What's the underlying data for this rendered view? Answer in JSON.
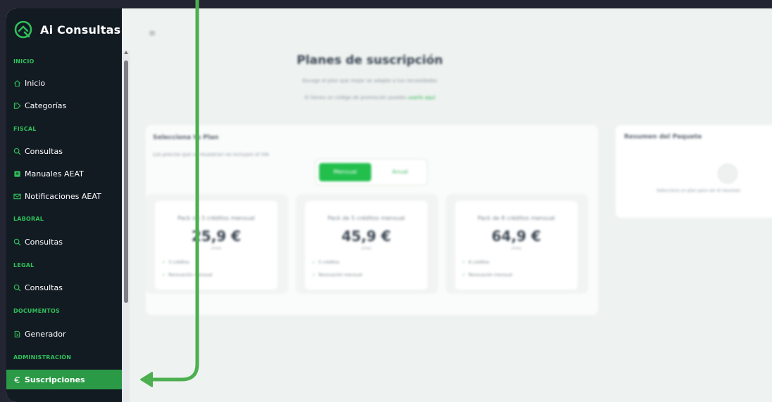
{
  "app": {
    "name": "Ai Consultas"
  },
  "sidebar": {
    "sections": [
      {
        "title": "INICIO",
        "items": [
          {
            "label": "Inicio",
            "icon": "home-icon"
          },
          {
            "label": "Categorías",
            "icon": "tag-icon"
          }
        ]
      },
      {
        "title": "FISCAL",
        "items": [
          {
            "label": "Consultas",
            "icon": "search-icon"
          },
          {
            "label": "Manuales AEAT",
            "icon": "book-icon"
          },
          {
            "label": "Notificaciones AEAT",
            "icon": "mail-icon"
          }
        ]
      },
      {
        "title": "LABORAL",
        "items": [
          {
            "label": "Consultas",
            "icon": "search-icon"
          }
        ]
      },
      {
        "title": "LEGAL",
        "items": [
          {
            "label": "Consultas",
            "icon": "search-icon"
          }
        ]
      },
      {
        "title": "DOCUMENTOS",
        "items": [
          {
            "label": "Generador",
            "icon": "document-icon"
          }
        ]
      },
      {
        "title": "ADMINISTRACIÓN",
        "items": [
          {
            "label": "Suscripciones",
            "icon": "euro-icon",
            "active": true
          }
        ]
      }
    ]
  },
  "main": {
    "menu_icon": "menu-icon",
    "title": "Planes de suscripción",
    "subtitle": "Escoge el plan que mejor se adapte a tus necesidades",
    "promo_text": "Si tienes un código de promoción puedes",
    "promo_link": "usarlo aquí",
    "plan_selector": {
      "title": "Selecciona tu Plan",
      "description": "Los precios que se muestran no incluyen el IVA",
      "billing_options": [
        "Mensual",
        "Anual"
      ],
      "selected_billing": "Mensual",
      "plans": [
        {
          "name": "Pack de 3 créditos mensual",
          "price": "25,9 €",
          "period": "/mes",
          "features": [
            "3 créditos",
            "Renovación mensual"
          ]
        },
        {
          "name": "Pack de 5 créditos mensual",
          "price": "45,9 €",
          "period": "/mes",
          "features": [
            "5 créditos",
            "Renovación mensual"
          ]
        },
        {
          "name": "Pack de 8 créditos mensual",
          "price": "64,9 €",
          "period": "/mes",
          "features": [
            "8 créditos",
            "Renovación mensual"
          ]
        }
      ]
    },
    "summary": {
      "title": "Resumen del Paquete",
      "empty_text": "Selecciona un plan para ver el resumen"
    }
  },
  "annotation": {
    "color": "#4caf50"
  },
  "colors": {
    "sidebar_bg": "#121a22",
    "accent": "#2fc15a",
    "active_item": "#2b9a47",
    "page_bg": "#eef2f0"
  }
}
